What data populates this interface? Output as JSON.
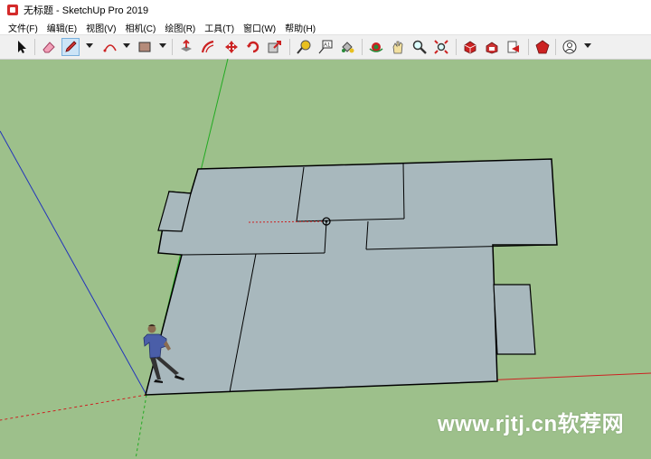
{
  "window": {
    "title": "无标题 - SketchUp Pro 2019",
    "icon": "sketchup-logo-icon"
  },
  "menu": [
    {
      "label": "文件(F)"
    },
    {
      "label": "编辑(E)"
    },
    {
      "label": "视图(V)"
    },
    {
      "label": "相机(C)"
    },
    {
      "label": "绘图(R)"
    },
    {
      "label": "工具(T)"
    },
    {
      "label": "窗口(W)"
    },
    {
      "label": "帮助(H)"
    }
  ],
  "toolbar": {
    "tools": [
      {
        "name": "select-tool-icon"
      },
      {
        "name": "eraser-tool-icon"
      },
      {
        "name": "pencil-line-tool-icon",
        "active": true
      },
      {
        "name": "arc-tool-icon"
      },
      {
        "name": "rectangle-tool-icon"
      },
      {
        "name": "push-pull-tool-icon"
      },
      {
        "name": "offset-tool-icon"
      },
      {
        "name": "move-tool-icon"
      },
      {
        "name": "rotate-tool-icon"
      },
      {
        "name": "scale-tool-icon"
      },
      {
        "name": "tape-measure-tool-icon"
      },
      {
        "name": "text-tool-icon"
      },
      {
        "name": "paint-bucket-tool-icon"
      },
      {
        "name": "orbit-tool-icon"
      },
      {
        "name": "pan-tool-icon"
      },
      {
        "name": "zoom-tool-icon"
      },
      {
        "name": "zoom-extents-tool-icon"
      },
      {
        "name": "3d-warehouse-icon"
      },
      {
        "name": "extension-warehouse-icon"
      },
      {
        "name": "send-to-layout-icon"
      },
      {
        "name": "extension-manager-icon"
      },
      {
        "name": "user-account-icon"
      }
    ],
    "text_tool_glyph": "A1"
  },
  "viewport": {
    "background_color": "#9dc08b",
    "face_color": "#a8b8bd",
    "axis_colors": {
      "red": "#cc2222",
      "green": "#22aa22",
      "blue": "#2233bb"
    }
  },
  "watermark": {
    "text": "www.rjtj.cn软荐网"
  }
}
